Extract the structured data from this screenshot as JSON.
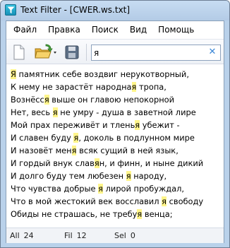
{
  "window": {
    "title": "Text Filter - [CWER.ws.txt]"
  },
  "menu": {
    "items": [
      "Файл",
      "Правка",
      "Поиск",
      "Вид",
      "Помощь"
    ]
  },
  "search": {
    "value": "я",
    "clear_icon": "close-icon"
  },
  "lines": [
    [
      {
        "t": "Я",
        "h": true
      },
      {
        "t": " памятник себе воздвиг нерукотворный,",
        "h": false
      }
    ],
    [
      {
        "t": "К нему не зарастёт народна",
        "h": false
      },
      {
        "t": "я",
        "h": true
      },
      {
        "t": " тропа,",
        "h": false
      }
    ],
    [
      {
        "t": "Вознёсс",
        "h": false
      },
      {
        "t": "я",
        "h": true
      },
      {
        "t": " выше он главою непокорной",
        "h": false
      }
    ],
    [
      {
        "t": "Нет, весь ",
        "h": false
      },
      {
        "t": "я",
        "h": true
      },
      {
        "t": " не умру - душа в заветной лире",
        "h": false
      }
    ],
    [
      {
        "t": "Мой прах переживёт и тлень",
        "h": false
      },
      {
        "t": "я",
        "h": true
      },
      {
        "t": " убежит -",
        "h": false
      }
    ],
    [
      {
        "t": "И славен буду ",
        "h": false
      },
      {
        "t": "я",
        "h": true
      },
      {
        "t": ", доколь в подлунном мире",
        "h": false
      }
    ],
    [
      {
        "t": "И назовёт мен",
        "h": false
      },
      {
        "t": "я",
        "h": true
      },
      {
        "t": " всяк сущий в ней язык,",
        "h": false
      }
    ],
    [
      {
        "t": "И гордый внук слав",
        "h": false
      },
      {
        "t": "я",
        "h": true
      },
      {
        "t": "н, и финн, и ныне дикий",
        "h": false
      }
    ],
    [
      {
        "t": "И долго буду тем любезен ",
        "h": false
      },
      {
        "t": "я",
        "h": true
      },
      {
        "t": " народу,",
        "h": false
      }
    ],
    [
      {
        "t": "Что чувства добрые ",
        "h": false
      },
      {
        "t": "я",
        "h": true
      },
      {
        "t": " лирой пробуждал,",
        "h": false
      }
    ],
    [
      {
        "t": "Что в мой жестокий век восславил ",
        "h": false
      },
      {
        "t": "я",
        "h": true
      },
      {
        "t": " свободу",
        "h": false
      }
    ],
    [
      {
        "t": "Обиды не страшась, не требу",
        "h": false
      },
      {
        "t": "я",
        "h": true
      },
      {
        "t": " венца;",
        "h": false
      }
    ]
  ],
  "status": {
    "all_label": "All",
    "all_value": "24",
    "fil_label": "Fil",
    "fil_value": "12",
    "sel_label": "Sel",
    "sel_value": "0"
  },
  "icons": {
    "app": "funnel-icon",
    "new": "new-document-icon",
    "open": "open-folder-icon",
    "save": "save-disk-icon"
  },
  "colors": {
    "highlight": "#fff58a",
    "frame": "#b9d1ea",
    "clear_icon": "#3a86d6"
  }
}
